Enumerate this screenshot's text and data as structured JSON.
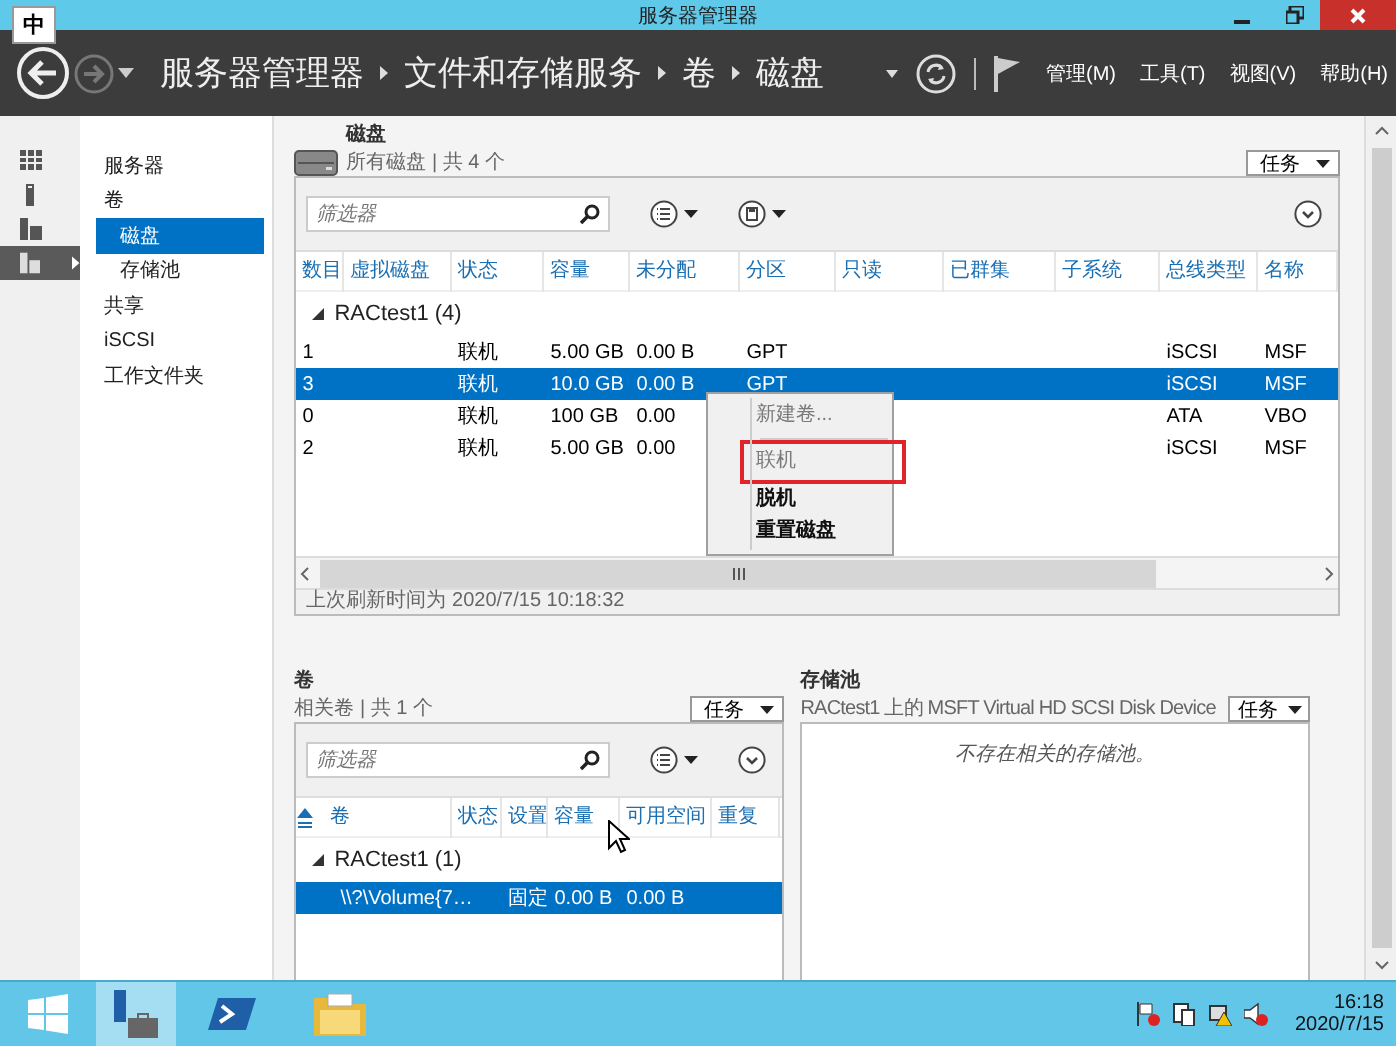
{
  "window": {
    "title": "服务器管理器",
    "input_indicator": "中"
  },
  "header": {
    "breadcrumb": [
      "服务器管理器",
      "文件和存储服务",
      "卷",
      "磁盘"
    ],
    "menus": [
      "管理(M)",
      "工具(T)",
      "视图(V)",
      "帮助(H)"
    ]
  },
  "icon_strip": [
    {
      "kind": "dashboard",
      "selected": false
    },
    {
      "kind": "server",
      "selected": false
    },
    {
      "kind": "servers",
      "selected": false
    },
    {
      "kind": "storage",
      "selected": true
    }
  ],
  "sidebar": {
    "items": [
      {
        "label": "服务器",
        "selected": false
      },
      {
        "label": "卷",
        "selected": false,
        "children": [
          {
            "label": "磁盘",
            "selected": true
          },
          {
            "label": "存储池",
            "selected": false
          }
        ]
      },
      {
        "label": "共享",
        "selected": false
      },
      {
        "label": "iSCSI",
        "selected": false
      },
      {
        "label": "工作文件夹",
        "selected": false
      }
    ]
  },
  "disks": {
    "title": "磁盘",
    "subtitle": "所有磁盘 | 共 4 个",
    "tasks": "任务",
    "filter_placeholder": "筛选器",
    "columns": [
      "数目",
      "虚拟磁盘",
      "状态",
      "容量",
      "未分配",
      "分区",
      "只读",
      "已群集",
      "子系统",
      "总线类型",
      "名称"
    ],
    "group": "RACtest1 (4)",
    "rows": [
      {
        "number": "1",
        "status": "联机",
        "capacity": "5.00 GB",
        "unallocated": "0.00 B",
        "partition": "GPT",
        "bus_type": "iSCSI",
        "name": "MSF",
        "selected": false
      },
      {
        "number": "3",
        "status": "联机",
        "capacity": "10.0 GB",
        "unallocated": "0.00 B",
        "partition": "GPT",
        "bus_type": "iSCSI",
        "name": "MSF",
        "selected": true
      },
      {
        "number": "0",
        "status": "联机",
        "capacity": "100 GB",
        "unallocated": "0.00",
        "bus_type": "ATA",
        "name": "VBO",
        "selected": false
      },
      {
        "number": "2",
        "status": "联机",
        "capacity": "5.00 GB",
        "unallocated": "0.00",
        "bus_type": "iSCSI",
        "name": "MSF",
        "selected": false
      }
    ],
    "status": "上次刷新时间为 2020/7/15 10:18:32"
  },
  "context_menu": [
    {
      "label": "新建卷...",
      "disabled": true,
      "annotated": false
    },
    {
      "kind": "separator"
    },
    {
      "label": "联机",
      "disabled": true,
      "annotated": true
    },
    {
      "label": "脱机",
      "disabled": false,
      "annotated": false
    },
    {
      "label": "重置磁盘",
      "disabled": false,
      "annotated": false
    }
  ],
  "volumes": {
    "title": "卷",
    "subtitle": "相关卷 | 共 1 个",
    "tasks": "任务",
    "filter_placeholder": "筛选器",
    "columns": [
      "卷",
      "状态",
      "设置",
      "容量",
      "可用空间",
      "重复"
    ],
    "group": "RACtest1 (1)",
    "rows": [
      {
        "volume": "\\\\?\\Volume{7…",
        "setting": "固定",
        "capacity": "0.00 B",
        "free": "0.00 B",
        "selected": true
      }
    ]
  },
  "storage_pool": {
    "title": "存储池",
    "subtitle": "RACtest1 上的 MSFT Virtual HD SCSI Disk Device",
    "tasks": "任务",
    "empty_message": "不存在相关的存储池。"
  },
  "taskbar": {
    "items": [
      {
        "kind": "server-manager",
        "selected": true
      },
      {
        "kind": "powershell",
        "selected": false
      },
      {
        "kind": "explorer",
        "selected": false
      }
    ],
    "time": "16:18",
    "date": "2020/7/15"
  }
}
